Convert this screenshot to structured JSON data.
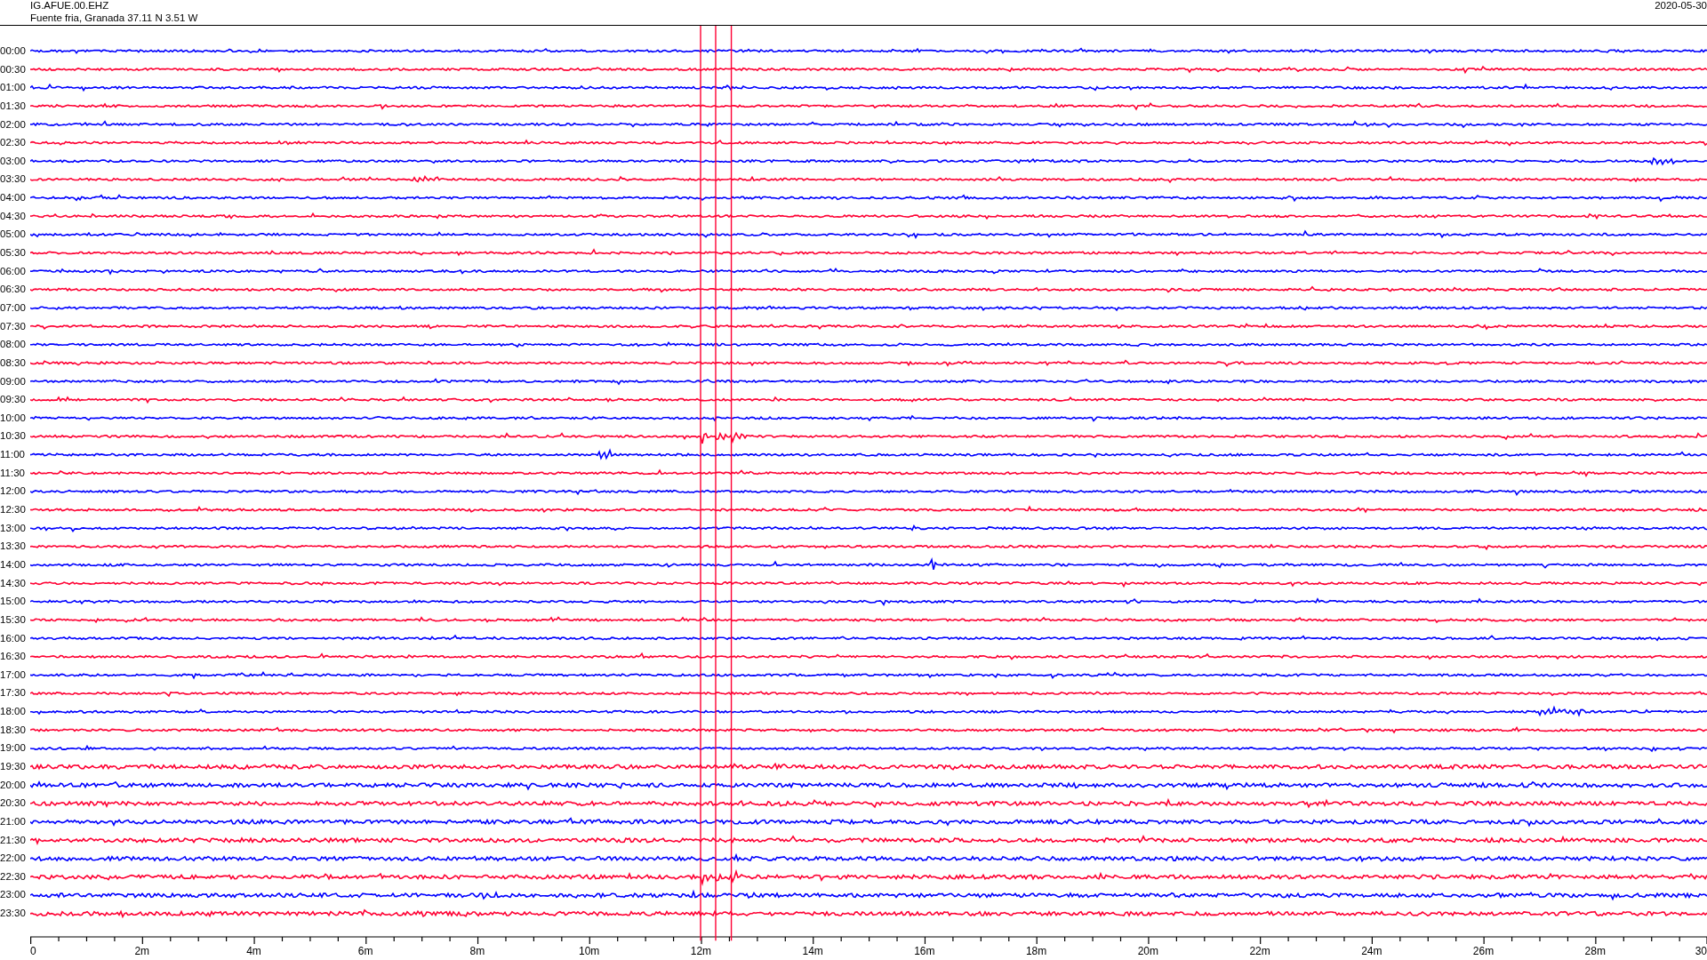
{
  "header": {
    "station": "IG.AFUE.00.EHZ",
    "location": "Fuente fria, Granada  37.11 N 3.51 W",
    "date": "2020-05-30"
  },
  "rows": [
    {
      "label": "00:00",
      "color": "#0000ff"
    },
    {
      "label": "00:30",
      "color": "#ff0033"
    },
    {
      "label": "01:00",
      "color": "#0000ff"
    },
    {
      "label": "01:30",
      "color": "#ff0033"
    },
    {
      "label": "02:00",
      "color": "#0000ff"
    },
    {
      "label": "02:30",
      "color": "#ff0033"
    },
    {
      "label": "03:00",
      "color": "#0000ff"
    },
    {
      "label": "03:30",
      "color": "#ff0033"
    },
    {
      "label": "04:00",
      "color": "#0000ff"
    },
    {
      "label": "04:30",
      "color": "#ff0033"
    },
    {
      "label": "05:00",
      "color": "#0000ff"
    },
    {
      "label": "05:30",
      "color": "#ff0033"
    },
    {
      "label": "06:00",
      "color": "#0000ff"
    },
    {
      "label": "06:30",
      "color": "#ff0033"
    },
    {
      "label": "07:00",
      "color": "#0000ff"
    },
    {
      "label": "07:30",
      "color": "#ff0033"
    },
    {
      "label": "08:00",
      "color": "#0000ff"
    },
    {
      "label": "08:30",
      "color": "#ff0033"
    },
    {
      "label": "09:00",
      "color": "#0000ff"
    },
    {
      "label": "09:30",
      "color": "#ff0033"
    },
    {
      "label": "10:00",
      "color": "#0000ff"
    },
    {
      "label": "10:30",
      "color": "#ff0033"
    },
    {
      "label": "11:00",
      "color": "#0000ff"
    },
    {
      "label": "11:30",
      "color": "#ff0033"
    },
    {
      "label": "12:00",
      "color": "#0000ff"
    },
    {
      "label": "12:30",
      "color": "#ff0033"
    },
    {
      "label": "13:00",
      "color": "#0000ff"
    },
    {
      "label": "13:30",
      "color": "#ff0033"
    },
    {
      "label": "14:00",
      "color": "#0000ff"
    },
    {
      "label": "14:30",
      "color": "#ff0033"
    },
    {
      "label": "15:00",
      "color": "#0000ff"
    },
    {
      "label": "15:30",
      "color": "#ff0033"
    },
    {
      "label": "16:00",
      "color": "#0000ff"
    },
    {
      "label": "16:30",
      "color": "#ff0033"
    },
    {
      "label": "17:00",
      "color": "#0000ff"
    },
    {
      "label": "17:30",
      "color": "#ff0033"
    },
    {
      "label": "18:00",
      "color": "#0000ff"
    },
    {
      "label": "18:30",
      "color": "#ff0033"
    },
    {
      "label": "19:00",
      "color": "#0000ff"
    },
    {
      "label": "19:30",
      "color": "#ff0033"
    },
    {
      "label": "20:00",
      "color": "#0000ff"
    },
    {
      "label": "20:30",
      "color": "#ff0033"
    },
    {
      "label": "21:00",
      "color": "#0000ff"
    },
    {
      "label": "21:30",
      "color": "#ff0033"
    },
    {
      "label": "22:00",
      "color": "#0000ff"
    },
    {
      "label": "22:30",
      "color": "#ff0033"
    },
    {
      "label": "23:00",
      "color": "#0000ff"
    },
    {
      "label": "23:30",
      "color": "#ff0033"
    }
  ],
  "x_axis": {
    "ticks": [
      "0",
      "2m",
      "4m",
      "6m",
      "8m",
      "10m",
      "12m",
      "14m",
      "16m",
      "18m",
      "20m",
      "22m",
      "24m",
      "26m",
      "28m",
      "30"
    ]
  }
}
